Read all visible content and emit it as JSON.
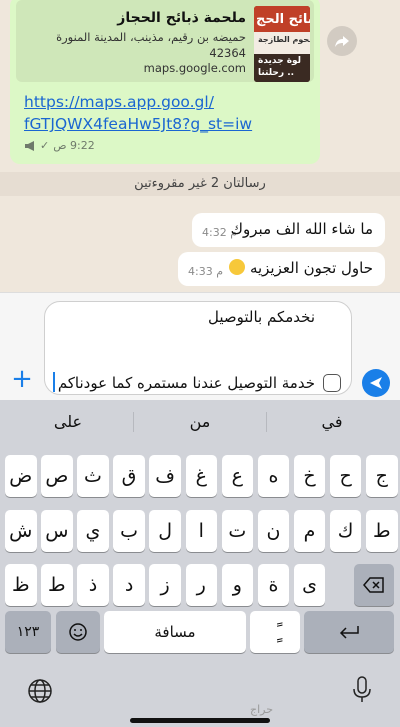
{
  "chat": {
    "outgoing": {
      "card_title": "ملحمة ذبائح الحجاز",
      "card_address": "حميضه بن رقيم، مذينب، المدينة المنورة 42364",
      "card_domain": "maps.google.com",
      "thumb_text_1": "بائح الحج",
      "thumb_text_2": "للحوم الطازجة",
      "thumb_text_3": "لوة جديدة",
      "thumb_text_4": "رحلتنا ..",
      "link_line1": "https://maps.app.goo.gl/",
      "link_line2": "fGTJQWX4feaHw5Jt8?g_st=iw",
      "time": "9:22 ص",
      "status": "✓"
    },
    "unread_banner": "رسالتان 2 غير مقروءتين",
    "incoming": [
      {
        "text": "ما شاء الله الف مبروك",
        "time": "4:32 م"
      },
      {
        "text": "حاول تجون العزيزيه",
        "time": "4:33 م"
      }
    ]
  },
  "composer": {
    "line1": "نخدمكم بالتوصيل",
    "line2": "خدمة التوصيل عندنا مستمره كما عودناكم",
    "plus_label": "+"
  },
  "keyboard": {
    "suggestions": [
      "على",
      "من",
      "في"
    ],
    "row1": [
      "ض",
      "ص",
      "ث",
      "ق",
      "ف",
      "غ",
      "ع",
      "ه",
      "خ",
      "ح",
      "ج"
    ],
    "row2": [
      "ش",
      "س",
      "ي",
      "ب",
      "ل",
      "ا",
      "ت",
      "ن",
      "م",
      "ك",
      "ط"
    ],
    "row3": [
      "ظ",
      "ط",
      "ذ",
      "د",
      "ز",
      "ر",
      "و",
      "ة",
      "ى"
    ],
    "numbers_label": "١٢٣",
    "space_label": "مسافة",
    "diacritic_label": "ًٍ"
  },
  "watermark": "حراج"
}
